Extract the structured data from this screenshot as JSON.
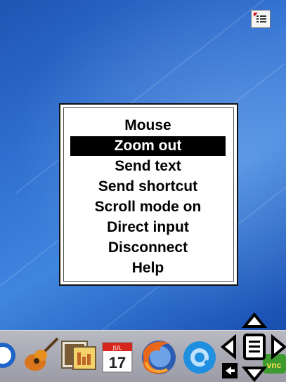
{
  "screen": {
    "menu": {
      "items": [
        {
          "label": "Mouse",
          "selected": false
        },
        {
          "label": "Zoom out",
          "selected": true
        },
        {
          "label": "Send text",
          "selected": false
        },
        {
          "label": "Send shortcut",
          "selected": false
        },
        {
          "label": "Scroll mode on",
          "selected": false
        },
        {
          "label": "Direct input",
          "selected": false
        },
        {
          "label": "Disconnect",
          "selected": false
        },
        {
          "label": "Help",
          "selected": false
        }
      ]
    },
    "dock": {
      "icons": [
        "app-icon",
        "guitar-icon",
        "photo-slideshow-icon",
        "calendar-icon",
        "firefox-icon",
        "quicktime-icon",
        "vnc-icon"
      ],
      "calendar_day": "17",
      "calendar_month": "JUL",
      "vnc_label": "vnc"
    },
    "colors": {
      "desktop": "#2f6fd0",
      "menu_bg": "#ffffff",
      "selected_bg": "#000000",
      "dock": "#a9a9b3"
    }
  }
}
